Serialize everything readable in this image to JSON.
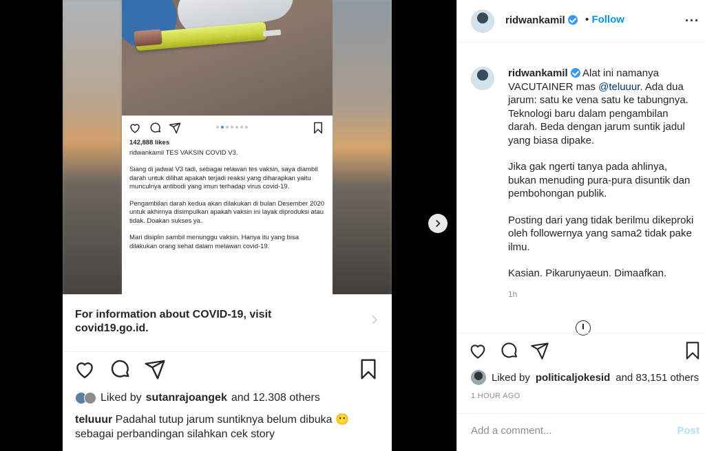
{
  "inner_post": {
    "likes": "142,888 likes",
    "caption_user": "ridwankamil",
    "caption_title": "TES VAKSIN COVID V3.",
    "para1": "Siang di jadwal V3 tadi, sebagai relawan tes vaksin, saya diambil darah untuk dilihat apakah terjadi reaksi yang diharapkan yaitu munculnya antibodi yang imun terhadap virus covid-19.",
    "para2": "Pengambilan darah kedua akan dilakukan di bulan Desember 2020 untuk akhirnya disimpulkan apakah vaksin ini layak diproduksi atau tidak. Doakan sukses ya.",
    "para3": "Mari disiplin sambil menunggu vaksin. Hanya itu yang bisa dilakukan orang sehat dalam melawan covid-19."
  },
  "covid_info": {
    "line1": "For information about COVID-19, visit",
    "line2": "covid19.go.id."
  },
  "outer_post": {
    "liked_by_prefix": "Liked by",
    "liked_by_user": "sutanrajoangek",
    "liked_by_suffix": "and 12.308 others",
    "caption_user": "teluuur",
    "caption_line1": "Padahal tutup jarum suntiknya belum dibuka 😶",
    "caption_line2": "sebagai perbandingan silahkan cek story"
  },
  "panel": {
    "username": "ridwankamil",
    "separator": "•",
    "follow_label": "Follow",
    "more_label": "···",
    "comment_user": "ridwankamil",
    "comment_p1_a": "Alat ini namanya VACUTAINER mas",
    "comment_mention": "@teluuur",
    "comment_p1_b": ". Ada dua jarum: satu ke vena satu ke tabungnya. Teknologi baru dalam pengambilan darah. Beda dengan jarum suntik jadul yang biasa dipake.",
    "comment_p2": "Jika gak ngerti tanya pada ahlinya, bukan menuding pura-pura disuntik dan pembohongan publik.",
    "comment_p3": "Posting dari yang tidak berilmu dikeproki oleh followernya yang sama2 tidak pake ilmu.",
    "comment_p4": "Kasian. Pikarunyaeun. Dimaafkan.",
    "comment_time": "1h",
    "liked_by_prefix": "Liked by",
    "liked_by_user": "politicaljokesid",
    "liked_by_suffix": "and 83,151 others",
    "time_ago": "1 HOUR AGO",
    "add_comment_placeholder": "Add a comment...",
    "post_label": "Post"
  },
  "colors": {
    "accent": "#0095f6",
    "verified": "#3897f0",
    "text": "#262626",
    "muted": "#8e8e8e",
    "post_disabled": "#b2dffc"
  },
  "icons": [
    "heart-icon",
    "comment-icon",
    "share-icon",
    "bookmark-icon",
    "chevron-right-icon",
    "next-arrow-icon",
    "verified-badge-icon",
    "more-options-icon",
    "load-more-icon"
  ]
}
